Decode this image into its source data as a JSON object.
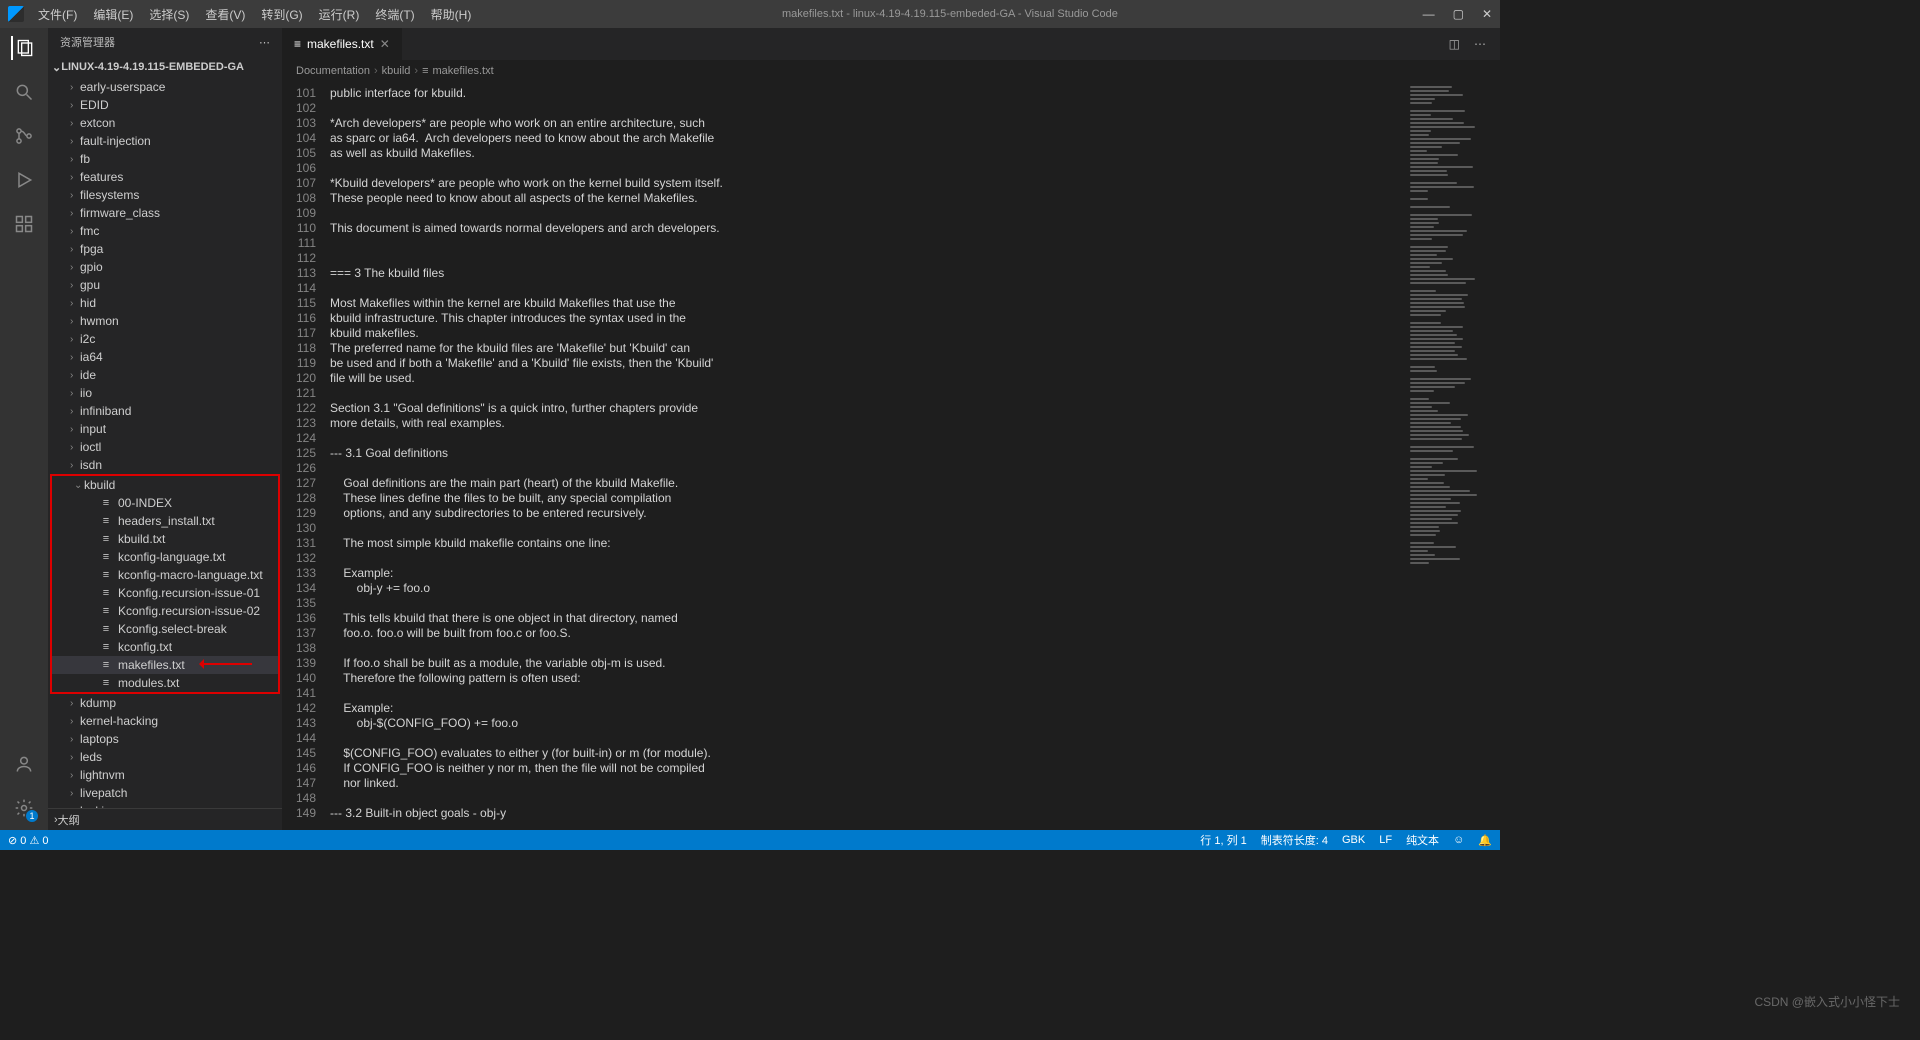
{
  "title": "makefiles.txt - linux-4.19-4.19.115-embeded-GA - Visual Studio Code",
  "menu": [
    "文件(F)",
    "编辑(E)",
    "选择(S)",
    "查看(V)",
    "转到(G)",
    "运行(R)",
    "终端(T)",
    "帮助(H)"
  ],
  "sidebar": {
    "title": "资源管理器",
    "project": "LINUX-4.19-4.19.115-EMBEDED-GA",
    "outline": "大纲"
  },
  "folders1": [
    "early-userspace",
    "EDID",
    "extcon",
    "fault-injection",
    "fb",
    "features",
    "filesystems",
    "firmware_class",
    "fmc",
    "fpga",
    "gpio",
    "gpu",
    "hid",
    "hwmon",
    "i2c",
    "ia64",
    "ide",
    "iio",
    "infiniband",
    "input",
    "ioctl",
    "isdn"
  ],
  "kbuild": {
    "name": "kbuild",
    "files": [
      "00-INDEX",
      "headers_install.txt",
      "kbuild.txt",
      "kconfig-language.txt",
      "kconfig-macro-language.txt",
      "Kconfig.recursion-issue-01",
      "Kconfig.recursion-issue-02",
      "Kconfig.select-break",
      "kconfig.txt",
      "makefiles.txt",
      "modules.txt"
    ]
  },
  "folders2": [
    "kdump",
    "kernel-hacking",
    "laptops",
    "leds",
    "lightnvm",
    "livepatch",
    "locking"
  ],
  "activeFile": "makefiles.txt",
  "tab": {
    "name": "makefiles.txt"
  },
  "breadcrumb": [
    "Documentation",
    "kbuild",
    "makefiles.txt"
  ],
  "lineStart": 101,
  "codeLines": [
    "public interface for kbuild.",
    "",
    "*Arch developers* are people who work on an entire architecture, such",
    "as sparc or ia64.  Arch developers need to know about the arch Makefile",
    "as well as kbuild Makefiles.",
    "",
    "*Kbuild developers* are people who work on the kernel build system itself.",
    "These people need to know about all aspects of the kernel Makefiles.",
    "",
    "This document is aimed towards normal developers and arch developers.",
    "",
    "",
    "=== 3 The kbuild files",
    "",
    "Most Makefiles within the kernel are kbuild Makefiles that use the",
    "kbuild infrastructure. This chapter introduces the syntax used in the",
    "kbuild makefiles.",
    "The preferred name for the kbuild files are 'Makefile' but 'Kbuild' can",
    "be used and if both a 'Makefile' and a 'Kbuild' file exists, then the 'Kbuild'",
    "file will be used.",
    "",
    "Section 3.1 \"Goal definitions\" is a quick intro, further chapters provide",
    "more details, with real examples.",
    "",
    "--- 3.1 Goal definitions",
    "",
    "    Goal definitions are the main part (heart) of the kbuild Makefile.",
    "    These lines define the files to be built, any special compilation",
    "    options, and any subdirectories to be entered recursively.",
    "",
    "    The most simple kbuild makefile contains one line:",
    "",
    "    Example:",
    "        obj-y += foo.o",
    "",
    "    This tells kbuild that there is one object in that directory, named",
    "    foo.o. foo.o will be built from foo.c or foo.S.",
    "",
    "    If foo.o shall be built as a module, the variable obj-m is used.",
    "    Therefore the following pattern is often used:",
    "",
    "    Example:",
    "        obj-$(CONFIG_FOO) += foo.o",
    "",
    "    $(CONFIG_FOO) evaluates to either y (for built-in) or m (for module).",
    "    If CONFIG_FOO is neither y nor m, then the file will not be compiled",
    "    nor linked.",
    "",
    "--- 3.2 Built-in object goals - obj-y"
  ],
  "status": {
    "left": [
      "⊘ 0 ⚠ 0"
    ],
    "right": [
      "行 1, 列 1",
      "制表符长度: 4",
      "GBK",
      "LF",
      "纯文本",
      "☺",
      "🔔"
    ]
  },
  "watermark": "CSDN @嵌入式小小怪下士"
}
